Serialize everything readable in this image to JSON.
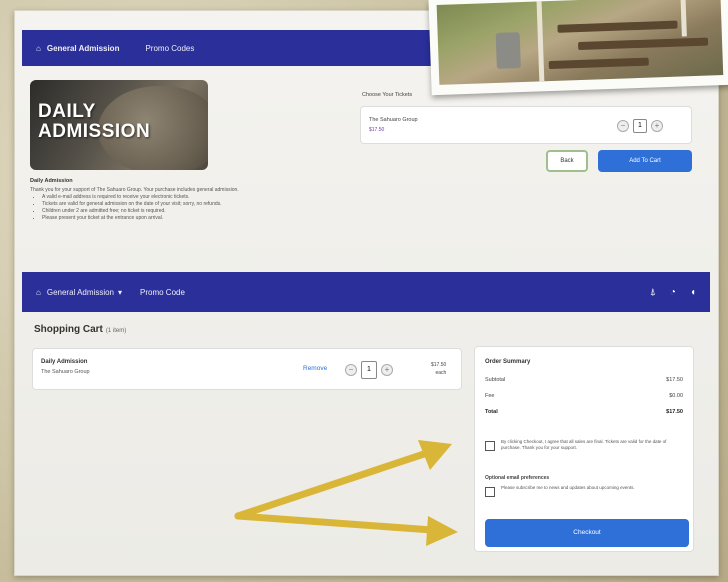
{
  "nav_top": {
    "items": [
      {
        "label": "General Admission",
        "icon": "home-icon"
      },
      {
        "label": "Promo Codes"
      }
    ]
  },
  "hero": {
    "title_line1": "DAILY",
    "title_line2": "ADMISSION"
  },
  "description": {
    "heading": "Daily Admission",
    "intro": "Thank you for your support of The Sahuaro Group. Your purchase includes general admission.",
    "bullets": [
      "A valid e-mail address is required to receive your electronic tickets.",
      "Tickets are valid for general admission on the date of your visit; sorry, no refunds.",
      "Children under 2 are admitted free; no ticket is required.",
      "Please present your ticket at the entrance upon arrival."
    ]
  },
  "product": {
    "section_label": "Choose Your Tickets",
    "name": "The Sahuaro Group",
    "price": "$17.50",
    "qty": "1",
    "back_label": "Back",
    "add_label": "Add To Cart"
  },
  "nav_bottom": {
    "items": [
      {
        "label": "General Admission",
        "icon": "home-icon"
      },
      {
        "label": "Promo Code"
      }
    ]
  },
  "cart": {
    "title": "Shopping Cart",
    "count": "(1 item)",
    "item": {
      "name": "Daily Admission",
      "subtitle": "The Sahuaro Group",
      "remove_label": "Remove",
      "qty": "1",
      "price": "$17.50",
      "price_unit": "each"
    }
  },
  "summary": {
    "heading": "Order Summary",
    "subtotal_label": "Subtotal",
    "subtotal_value": "$17.50",
    "fee_label": "Fee",
    "fee_value": "$0.00",
    "total_label": "Total",
    "total_value": "$17.50",
    "agree_text": "By clicking Checkout, I agree that all sales are final. Tickets are valid for the date of purchase. Thank you for your support.",
    "optional_label": "Optional email preferences",
    "optin_text": "Please subscribe me to news and updates about upcoming events.",
    "checkout_label": "Checkout"
  },
  "colors": {
    "nav": "#2a2f9a",
    "primary_button": "#2f6fd8",
    "arrow": "#d9b637"
  }
}
